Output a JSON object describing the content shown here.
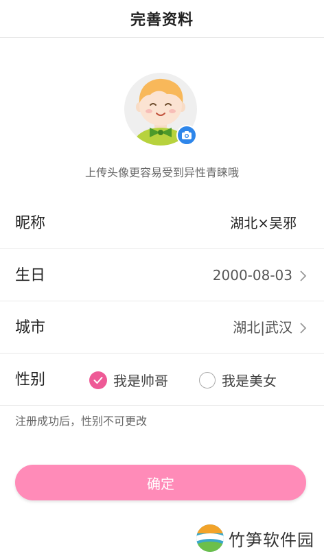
{
  "header": {
    "title": "完善资料"
  },
  "avatar": {
    "hint": "上传头像更容易受到异性青睐哦"
  },
  "form": {
    "nickname": {
      "label": "昵称",
      "value": "湖北×吴邪"
    },
    "birthday": {
      "label": "生日",
      "value": "2000-08-03"
    },
    "city": {
      "label": "城市",
      "value": "湖北|武汉"
    },
    "gender": {
      "label": "性别",
      "options": [
        {
          "label": "我是帅哥",
          "selected": true
        },
        {
          "label": "我是美女",
          "selected": false
        }
      ]
    },
    "note": "注册成功后，性别不可更改"
  },
  "confirm_label": "确定",
  "watermark": {
    "text": "竹笋软件园"
  },
  "colors": {
    "accent": "#ff8bb8",
    "radio": "#ee5a96",
    "camera": "#2e86ea"
  }
}
